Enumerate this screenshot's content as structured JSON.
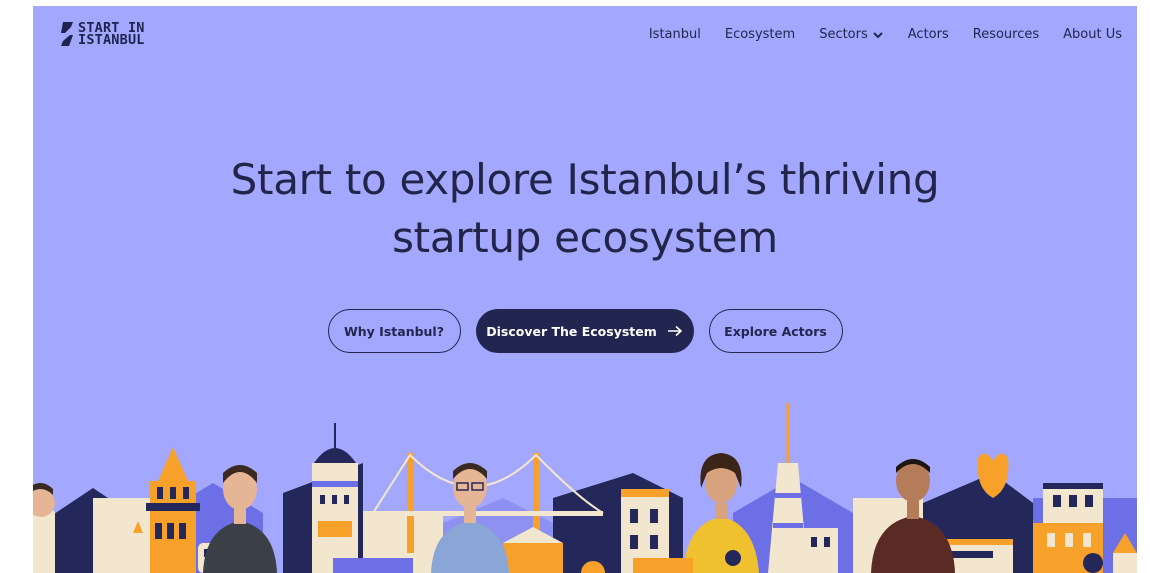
{
  "logo": {
    "line1": "START IN",
    "line2": "ISTANBUL"
  },
  "nav": {
    "items": [
      {
        "label": "Istanbul",
        "has_dropdown": false
      },
      {
        "label": "Ecosystem",
        "has_dropdown": false
      },
      {
        "label": "Sectors",
        "has_dropdown": true
      },
      {
        "label": "Actors",
        "has_dropdown": false
      },
      {
        "label": "Resources",
        "has_dropdown": false
      },
      {
        "label": "About Us",
        "has_dropdown": false
      }
    ]
  },
  "hero": {
    "title_line1": "Start to explore Istanbul’s thriving",
    "title_line2": "startup ecosystem"
  },
  "buttons": {
    "why": "Why Istanbul?",
    "discover": "Discover The Ecosystem",
    "actors": "Explore Actors"
  },
  "colors": {
    "background": "#a3a8fe",
    "navy": "#22254f",
    "orange": "#f7a12b",
    "cream": "#f3e6cf",
    "violet": "#6d6fe6"
  },
  "icons": [
    "logo-mark-icon",
    "chevron-down-icon",
    "arrow-right-icon"
  ]
}
